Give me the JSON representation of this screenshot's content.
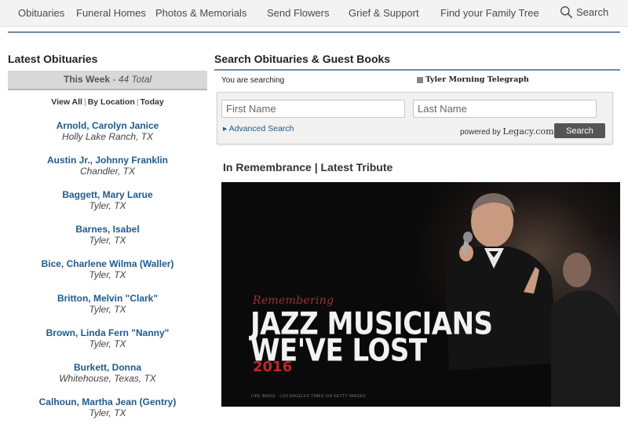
{
  "nav": {
    "items": [
      "Obituaries",
      "Funeral Homes",
      "Photos & Memorials",
      "Send Flowers",
      "Grief & Support",
      "Find your Family Tree"
    ],
    "search_label": "Search"
  },
  "left": {
    "title": "Latest Obituaries",
    "week_label": "This Week",
    "week_total": " - 44 Total",
    "view_all": "View All",
    "by_location": "By Location",
    "today": "Today",
    "obituaries": [
      {
        "name": "Arnold, Carolyn Janice",
        "location": "Holly Lake Ranch, TX"
      },
      {
        "name": "Austin Jr., Johnny Franklin",
        "location": "Chandler, TX"
      },
      {
        "name": "Baggett, Mary Larue",
        "location": "Tyler, TX"
      },
      {
        "name": "Barnes, Isabel",
        "location": "Tyler, TX"
      },
      {
        "name": "Bice, Charlene Wilma (Waller)",
        "location": "Tyler, TX"
      },
      {
        "name": "Britton, Melvin \"Clark\"",
        "location": "Tyler, TX"
      },
      {
        "name": "Brown, Linda Fern \"Nanny\"",
        "location": "Tyler, TX"
      },
      {
        "name": "Burkett, Donna",
        "location": "Whitehouse, Texas, TX"
      },
      {
        "name": "Calhoun, Martha Jean (Gentry)",
        "location": "Tyler, TX"
      }
    ]
  },
  "search": {
    "title": "Search Obituaries & Guest Books",
    "you_are_searching": "You are searching",
    "newspaper": "Tyler Morning Telegraph",
    "first_name_placeholder": "First Name",
    "last_name_placeholder": "Last Name",
    "advanced": "▸ Advanced Search",
    "powered_by": "powered by ",
    "legacy": "Legacy.com",
    "button": "Search"
  },
  "remembrance": {
    "title": "In Remembrance | Latest Tribute",
    "pre": "Remembering",
    "line1": "JAZZ MUSICIANS",
    "line2": "WE'VE LOST",
    "year": "2016",
    "credit": "LIFE IMAGE · LOS ANGELES TIMES VIA GETTY IMAGES"
  },
  "colors": {
    "link": "#1f5a8c",
    "rule": "#6f8aa2",
    "accent_red": "#c0262b"
  }
}
